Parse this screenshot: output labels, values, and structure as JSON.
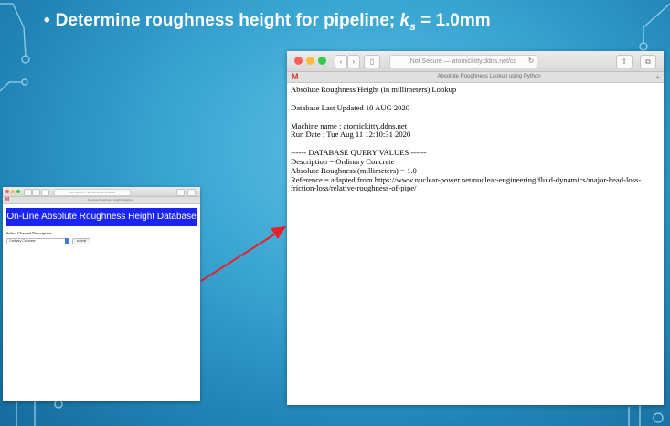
{
  "slide": {
    "title_text": "Determine roughness height for pipeline; ",
    "ks_symbol": "k",
    "ks_sub": "s",
    "ks_value": " = 1.0mm"
  },
  "browser_large": {
    "address": "Not Secure — atomickitty.ddns.net/co",
    "tab_title": "Absolute Roughness Lookup using Python",
    "tab_icon": "M",
    "page": {
      "heading": "Absolute Roughness Height (in millimeters) Lookup",
      "db_updated": "Database Last Updated 10 AUG 2020",
      "machine": "Machine name : atomickitty.ddns.net",
      "run_date": "Run Date : Tue Aug 11 12:10:31 2020",
      "query_header": "------ DATABASE QUERY VALUES ------",
      "description": "Description = Ordinary Concrete",
      "roughness": "Absolute Roughness (millimeters) = 1.0",
      "reference": "Reference = adapted from https://www.nuclear-power.net/nuclear-engineering/fluid-dynamics/major-head-loss-friction-loss/relative-roughness-of-pipe/"
    }
  },
  "browser_small": {
    "address": "Not Secure — atomickitty.ddns.net/co",
    "tab_title": "Absolute Roughness Height Database",
    "tab_icon": "M",
    "banner": "On-Line Absolute Roughness Height Database",
    "select_label": "Select Channel Description",
    "select_value": "Ordinary Concrete",
    "submit_label": "submit"
  },
  "colors": {
    "accent_banner": "#1a25f5",
    "arrow": "#e8202a",
    "traffic_red": "#fc605c",
    "traffic_yellow": "#fdbc40",
    "traffic_green": "#34c84a"
  }
}
